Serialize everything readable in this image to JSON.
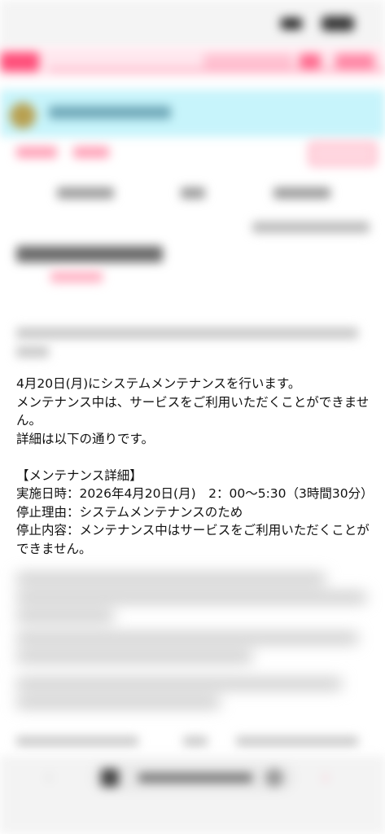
{
  "status_bar": {
    "time": "",
    "battery": ""
  },
  "content": {
    "paragraph1": [
      "4月20日(月)にシステムメンテナンスを行います。",
      "メンテナンス中は、サービスをご利用いただくことができません。",
      "詳細は以下の通りです。"
    ],
    "details_heading": "【メンテナンス詳細】",
    "details": [
      "実施日時：2026年4月20日(月)　2：00〜5:30（3時間30分）",
      "停止理由：システムメンテナンスのため",
      "停止内容：メンテナンス中はサービスをご利用いただくことができません。"
    ]
  },
  "colors": {
    "accent_pink": "#ff4f7a",
    "banner_cyan": "#c7f4fb"
  }
}
